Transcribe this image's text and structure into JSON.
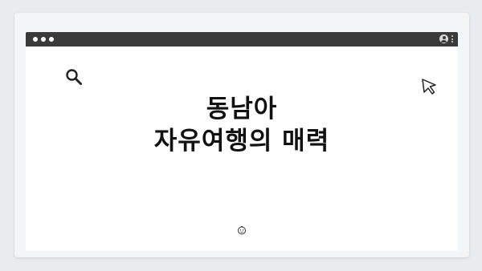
{
  "window": {
    "controls": [
      "close",
      "minimize",
      "maximize"
    ],
    "right_icons": [
      "user-icon",
      "kebab-menu-icon"
    ]
  },
  "content": {
    "heading_lines": [
      "동남아",
      "자유여행의 매력"
    ],
    "icons": [
      "search-icon",
      "cursor-pointer-icon",
      "smiley-face-icon"
    ]
  },
  "colors": {
    "page_background": "#e9ecef",
    "titlebar": "#3a3a3a",
    "content_background": "#ffffff",
    "heading_text": "#111111"
  }
}
